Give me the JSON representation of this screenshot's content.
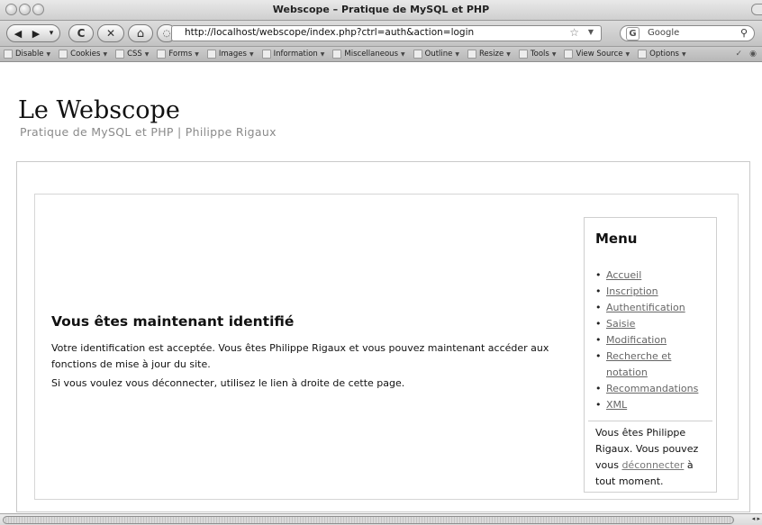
{
  "window": {
    "title": "Webscope – Pratique de MySQL et PHP"
  },
  "toolbar": {
    "back_symbol": "◀",
    "forward_symbol": "▶",
    "history_drop_symbol": "▾",
    "reload_symbol": "C",
    "stop_symbol": "✕",
    "home_symbol": "⌂",
    "url": "http://localhost/webscope/index.php?ctrl=auth&action=login",
    "bookmark_star": "☆",
    "url_drop": "▼",
    "search_engine_symbol": "G",
    "search_placeholder": "Google",
    "search_symbol": "⚲"
  },
  "devbar": {
    "items": [
      "Disable",
      "Cookies",
      "CSS",
      "Forms",
      "Images",
      "Information",
      "Miscellaneous",
      "Outline",
      "Resize",
      "Tools",
      "View Source",
      "Options"
    ]
  },
  "site": {
    "title": "Le Webscope",
    "subtitle": "Pratique de MySQL et PHP | Philippe Rigaux"
  },
  "content": {
    "heading": "Vous êtes maintenant identifié",
    "paragraph1": "Votre identification est acceptée. Vous êtes Philippe Rigaux et vous pouvez maintenant accéder aux fonctions de mise à jour du site.",
    "paragraph2": "Si vous voulez vous déconnecter, utilisez le lien à droite de cette page."
  },
  "menu": {
    "title": "Menu",
    "items": [
      "Accueil",
      "Inscription",
      "Authentification",
      "Saisie",
      "Modification",
      "Recherche et notation",
      "Recommandations",
      "XML"
    ],
    "note_prefix": "Vous êtes Philippe Rigaux. Vous pouvez vous",
    "note_link": "déconnecter",
    "note_suffix": "à tout moment."
  },
  "scrollbar": {
    "arrows": "◂ ▸"
  }
}
